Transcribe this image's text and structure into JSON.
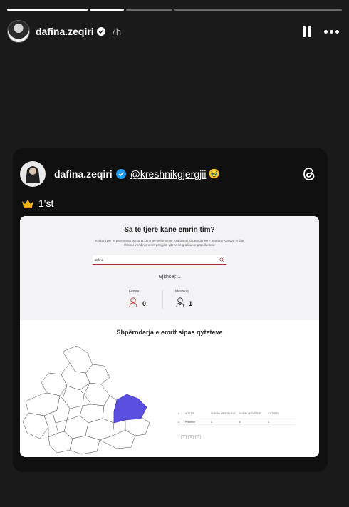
{
  "story": {
    "progress_done": 2,
    "progress_total": 4,
    "username": "dafina.zeqiri",
    "time": "7h"
  },
  "post": {
    "username": "dafina.zeqiri",
    "mention": "@kreshnikgjergjii",
    "emoji": "🥹",
    "text": "1'st",
    "crown_icon": "crown-icon"
  },
  "screenshot": {
    "title": "Sa të tjerë kanë emrin tim?",
    "description": "Kërkoni për të parë se sa persona kanë të njëjtin emër. Krahasoni shpërndarjen e emrit në Kosovë si dhe shikoni trendin e emrit përgjatë viteve në grafikun e popullaritetit.",
    "search_value": "dafina",
    "total": "Gjithsej: 1",
    "female_label": "Femra",
    "female_count": "0",
    "male_label": "Meshkuj",
    "male_count": "1",
    "map_title": "Shpërndarja e emrit sipas qyteteve",
    "highlighted_region": "Prishtinë",
    "table_headers": [
      "#",
      "VITETIT",
      "NUMRI I MESHKUJVE",
      "NUMRI I FEMRAVE",
      "GJITHSEJ"
    ],
    "table_row": [
      "1",
      "Prishtinë",
      "1",
      "0",
      "1"
    ],
    "pager": [
      "‹",
      "1",
      "›"
    ],
    "accent_color": "#5b4fe0"
  }
}
